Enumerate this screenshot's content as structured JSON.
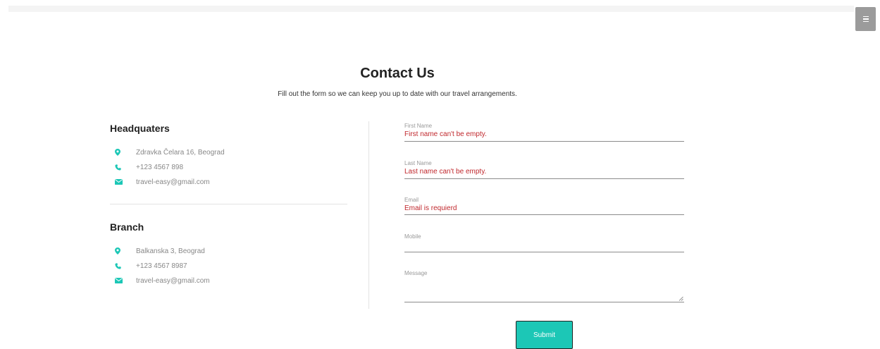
{
  "header": {
    "menu_icon": "hamburger-icon"
  },
  "page": {
    "title": "Contact Us",
    "subtitle": "Fill out the form so we can keep you up to date with our travel arrangements."
  },
  "offices": [
    {
      "name": "Headquaters",
      "address": "Zdravka Čelara 16, Beograd",
      "phone": "+123 4567 898",
      "email": "travel-easy@gmail.com"
    },
    {
      "name": "Branch",
      "address": "Balkanska 3, Beograd",
      "phone": "+123 4567 8987",
      "email": "travel-easy@gmail.com"
    }
  ],
  "form": {
    "first_name": {
      "label": "First Name",
      "error": "First name can't be empty."
    },
    "last_name": {
      "label": "Last Name",
      "error": "Last name can't be empty."
    },
    "email": {
      "label": "Email",
      "error": "Email is requierd"
    },
    "mobile": {
      "label": "Mobile"
    },
    "message": {
      "label": "Message"
    },
    "submit_label": "Submit"
  },
  "colors": {
    "accent": "#1cc7b6",
    "error": "#c0282d",
    "icon": "#1cc7b6"
  }
}
